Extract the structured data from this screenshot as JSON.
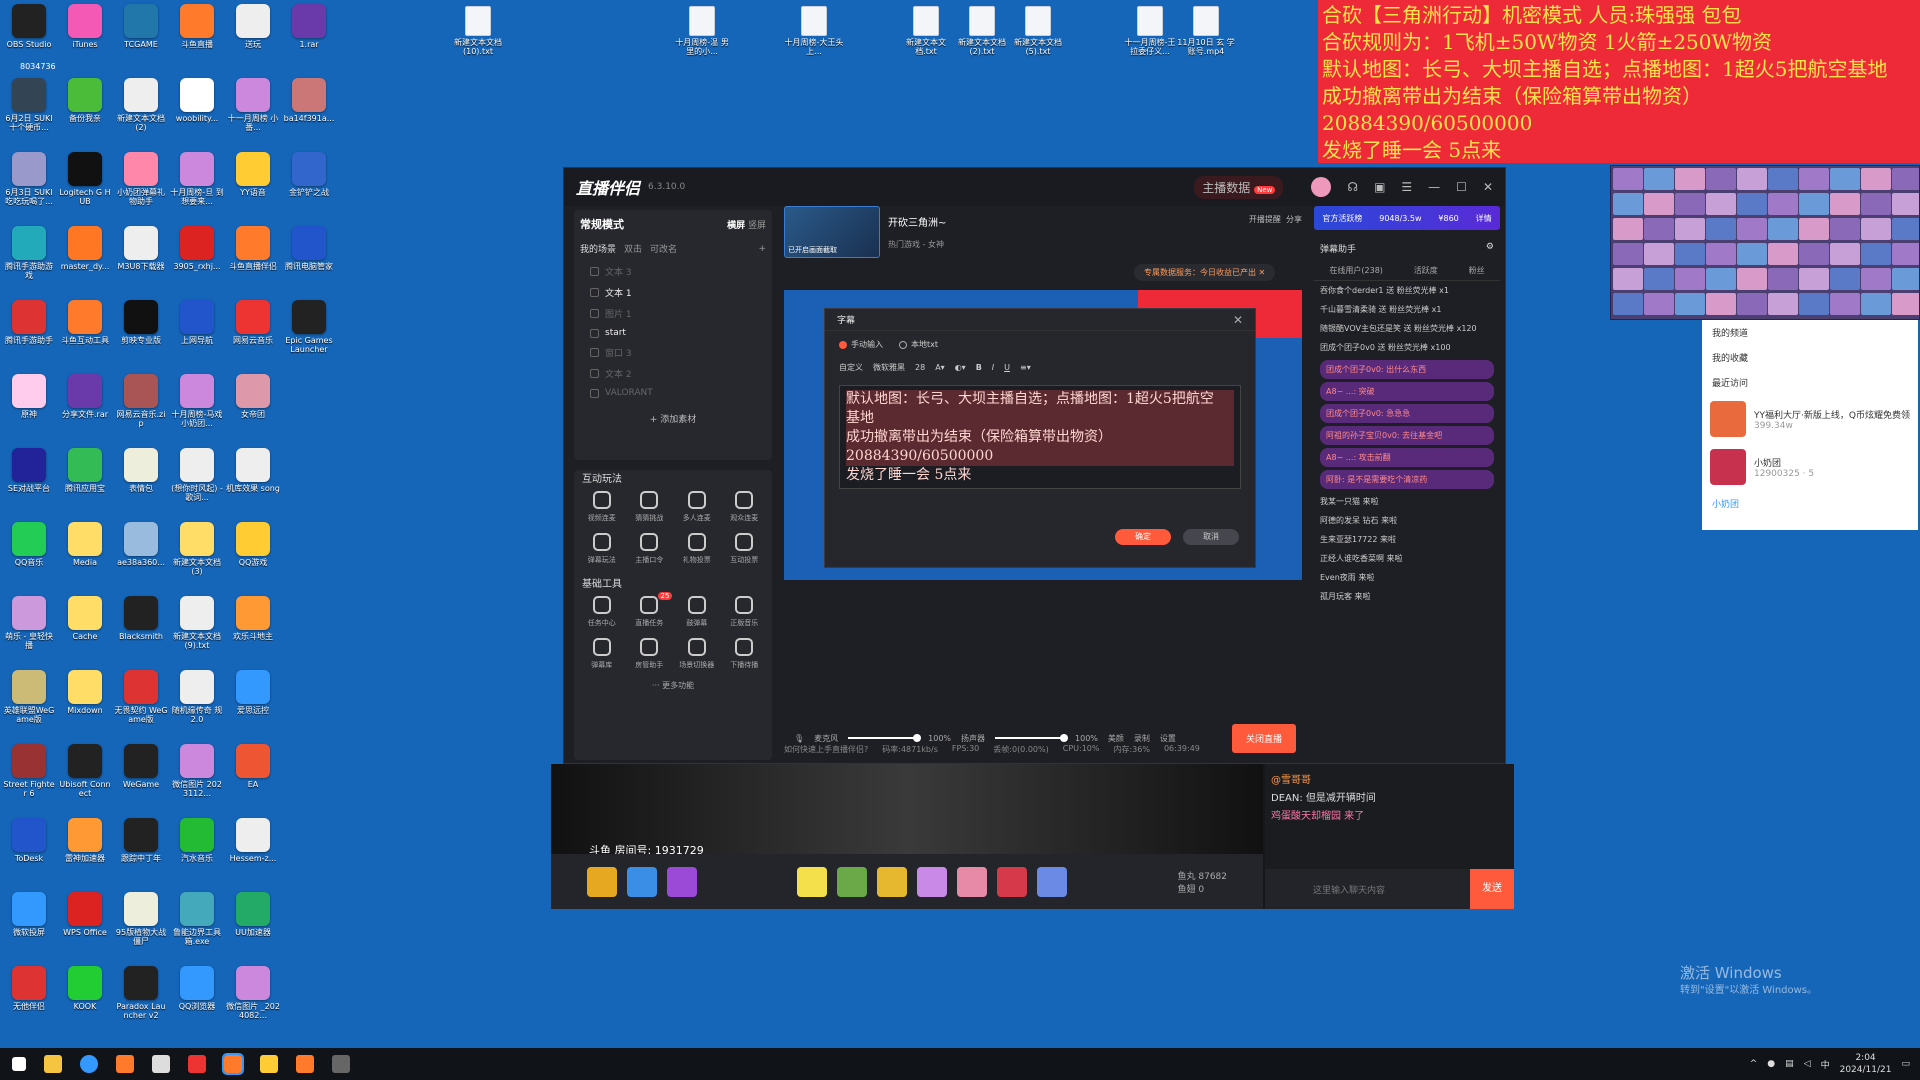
{
  "desktop": {
    "icons": [
      {
        "label": "OBS Studio",
        "color": "#222"
      },
      {
        "label": "iTunes",
        "color": "#f45ab5"
      },
      {
        "label": "TCGAME",
        "color": "#27a"
      },
      {
        "label": "斗鱼直播",
        "color": "#ff7a2a"
      },
      {
        "label": "送玩",
        "color": "#eee"
      },
      {
        "label": "1.rar",
        "color": "#6a3aaa"
      },
      {
        "label": "6月2日 SUKI 十个硬币...",
        "color": "#345"
      },
      {
        "label": "备份我亲",
        "color": "#4bbb3a"
      },
      {
        "label": "新建文本文档 (2)",
        "color": "#eee"
      },
      {
        "label": "woobility...",
        "color": "#fff"
      },
      {
        "label": "十一月周榜 小番...",
        "color": "#c8d"
      },
      {
        "label": "ba14f391a...",
        "color": "#c77"
      },
      {
        "label": "6月3日 SUKI 吃吃玩喝了...",
        "color": "#99c"
      },
      {
        "label": "Logitech G HUB",
        "color": "#111"
      },
      {
        "label": "小奶团弹幕礼物助手",
        "color": "#f8a"
      },
      {
        "label": "十月周榜-旦 到想要来...",
        "color": "#c8d"
      },
      {
        "label": "YY语音",
        "color": "#fc3"
      },
      {
        "label": "金铲铲之战",
        "color": "#36c"
      },
      {
        "label": "腾讯手游助游戏",
        "color": "#2ab"
      },
      {
        "label": "master_dy...",
        "color": "#f72"
      },
      {
        "label": "M3U8下载器",
        "color": "#eee"
      },
      {
        "label": "3905_rxhj...",
        "color": "#d22"
      },
      {
        "label": "斗鱼直播伴侣",
        "color": "#ff7a2a"
      },
      {
        "label": "腾讯电脑管家",
        "color": "#25c"
      },
      {
        "label": "腾讯手游助手",
        "color": "#d33"
      },
      {
        "label": "斗鱼互动工具",
        "color": "#ff7a2a"
      },
      {
        "label": "剪映专业版",
        "color": "#111"
      },
      {
        "label": "上网导航",
        "color": "#25c"
      },
      {
        "label": "网易云音乐",
        "color": "#e33"
      },
      {
        "label": "Epic Games Launcher",
        "color": "#222"
      },
      {
        "label": "原神",
        "color": "#fce"
      },
      {
        "label": "分享文件.rar",
        "color": "#6a3aaa"
      },
      {
        "label": "网易云音乐.zip",
        "color": "#a55"
      },
      {
        "label": "十月周榜-马戏小奶团...",
        "color": "#c8d"
      },
      {
        "label": "女帝团",
        "color": "#d9a"
      },
      {
        "label": "",
        "color": "#1565b8"
      },
      {
        "label": "SE对战平台",
        "color": "#229"
      },
      {
        "label": "腾讯应用宝",
        "color": "#3b5"
      },
      {
        "label": "表情包",
        "color": "#eed"
      },
      {
        "label": "(想你时风起) - 歌词...",
        "color": "#eee"
      },
      {
        "label": "机库效果 song",
        "color": "#eee"
      },
      {
        "label": "",
        "color": "#1565b8"
      },
      {
        "label": "QQ音乐",
        "color": "#2c5"
      },
      {
        "label": "Media",
        "color": "#fd6"
      },
      {
        "label": "ae38a360...",
        "color": "#9bd"
      },
      {
        "label": "新建文本文档 (3)",
        "color": "#fd6"
      },
      {
        "label": "QQ游戏",
        "color": "#fc3"
      },
      {
        "label": "",
        "color": "#1565b8"
      },
      {
        "label": "萌乐 - 皇轻快播",
        "color": "#c9d"
      },
      {
        "label": "Cache",
        "color": "#fd6"
      },
      {
        "label": "Blacksmith",
        "color": "#222"
      },
      {
        "label": "新建文本文档 (9).txt",
        "color": "#eee"
      },
      {
        "label": "欢乐斗地主",
        "color": "#f93"
      },
      {
        "label": "",
        "color": "#1565b8"
      },
      {
        "label": "英雄联盟WeGame版",
        "color": "#cb7"
      },
      {
        "label": "Mixdown",
        "color": "#fd6"
      },
      {
        "label": "无畏契约 WeGame版",
        "color": "#d33"
      },
      {
        "label": "随机缘传奇 规2.0",
        "color": "#eee"
      },
      {
        "label": "爱思远控",
        "color": "#39f"
      },
      {
        "label": "",
        "color": "#1565b8"
      },
      {
        "label": "Street Fighter 6",
        "color": "#933"
      },
      {
        "label": "Ubisoft Connect",
        "color": "#222"
      },
      {
        "label": "WeGame",
        "color": "#222"
      },
      {
        "label": "微信图片 2023112...",
        "color": "#c8d"
      },
      {
        "label": "EA",
        "color": "#e53"
      },
      {
        "label": "",
        "color": "#1565b8"
      },
      {
        "label": "ToDesk",
        "color": "#25c"
      },
      {
        "label": "雷神加速器",
        "color": "#f93"
      },
      {
        "label": "跟踪中丁年",
        "color": "#222"
      },
      {
        "label": "汽水音乐",
        "color": "#2b3"
      },
      {
        "label": "Hessem-z...",
        "color": "#eee"
      },
      {
        "label": "",
        "color": "#1565b8"
      },
      {
        "label": "微软投屏",
        "color": "#39f"
      },
      {
        "label": "WPS Office",
        "color": "#d22"
      },
      {
        "label": "95版植物大战僵尸",
        "color": "#eed"
      },
      {
        "label": "鲁能边界工具箱.exe",
        "color": "#4ab"
      },
      {
        "label": "UU加速器",
        "color": "#2a6"
      },
      {
        "label": "",
        "color": "#1565b8"
      },
      {
        "label": "无他伴侣",
        "color": "#d33"
      },
      {
        "label": "KOOK",
        "color": "#2c3"
      },
      {
        "label": "Paradox Launcher v2",
        "color": "#222"
      },
      {
        "label": "QQ浏览器",
        "color": "#39f"
      },
      {
        "label": "微信图片 _2024082...",
        "color": "#c8d"
      },
      {
        "label": "",
        "color": "#1565b8"
      }
    ],
    "obs_extra": "8034736",
    "top_files": [
      {
        "label": "新建文本文档 (10).txt"
      },
      {
        "label": "十月周榜-温 男里的小..."
      },
      {
        "label": "十月周榜-大王头上..."
      },
      {
        "label": "新建文本文档.txt"
      },
      {
        "label": "新建文本文档 (2).txt"
      },
      {
        "label": "新建文本文档 (5).txt"
      },
      {
        "label": "十一月周榜-王 拉委仔义..."
      },
      {
        "label": "11月10日 玄 学账号.mp4"
      }
    ]
  },
  "overlay": {
    "lines": [
      "合砍【三角洲行动】机密模式 人员:珠强强 包包",
      "合砍规则为：1飞机±50W物资 1火箭±250W物资",
      "默认地图：长弓、大坝主播自选；点播地图：1超火5把航空基地",
      "成功撤离带出为结束（保险箱算带出物资）",
      "20884390/60500000",
      "发烧了睡一会 5点来"
    ]
  },
  "sidepanel": {
    "items": [
      "我的频道",
      "我的收藏",
      "最近访问"
    ],
    "live1": {
      "title": "YY福利大厅·新版上线，Q币炫耀免费领",
      "count": "399.34w"
    },
    "live2": {
      "title": "小奶团",
      "id": "12900325",
      "count": "5"
    },
    "footer": "小奶团"
  },
  "app": {
    "title": "直播伴侣",
    "version": "6.3.10.0",
    "pill": "主播数据",
    "pill_badge": "New",
    "mode": "常规模式",
    "tab_landscape": "横屏",
    "tab_portrait": "竖屏",
    "scene_tabs": [
      "我的场景",
      "双击",
      "可改名"
    ],
    "scenes": [
      {
        "label": "文本 3",
        "on": false
      },
      {
        "label": "文本 1",
        "on": true
      },
      {
        "label": "图片 1",
        "on": false
      },
      {
        "label": "start",
        "on": true
      },
      {
        "label": "窗口 3",
        "on": false
      },
      {
        "label": "文本 2",
        "on": false
      },
      {
        "label": "VALORANT",
        "on": false
      }
    ],
    "add_material": "+ 添加素材",
    "interactive_title": "互动玩法",
    "interactive": [
      "视频连麦",
      "猜猜挑战",
      "多人连麦",
      "观众连麦",
      "弹幕玩法",
      "主播口令",
      "礼物投票",
      "互动投票"
    ],
    "tools_title": "基础工具",
    "tools": [
      "任务中心",
      "直播任务",
      "鼓弹幕",
      "正版音乐",
      "弹幕库",
      "房管助手",
      "场景切换器",
      "下播待播"
    ],
    "tools_badge": "25",
    "more": "··· 更多功能",
    "stream_title": "开砍三角洲~",
    "stream_cat": "热门游戏 - 女神",
    "thumb_cap": "已开启画面截取",
    "notice": "专属数据服务：今日收益已产出",
    "open_reminder": "开播提醒",
    "share": "分享",
    "rank": {
      "label": "官方活跃榜",
      "value": "9048/3.5w",
      "reward": "¥860",
      "btn": "详情"
    }
  },
  "dialog": {
    "title": "字幕",
    "radio_manual": "手动输入",
    "radio_local": "本地txt",
    "fmt_style": "自定义",
    "fmt_font": "微软雅黑",
    "fmt_size": "28",
    "lines": [
      "默认地图：长弓、大坝主播自选；点播地图：1超火5把航空",
      "基地",
      "成功撤离带出为结束（保险箱算带出物资）",
      "20884390/60500000",
      "发烧了睡一会 5点来"
    ],
    "ok": "确定",
    "cancel": "取消"
  },
  "audio": {
    "mic": "麦克风",
    "mic_vol": "100%",
    "speaker": "扬声器",
    "speaker_vol": "100%",
    "beauty": "美颜",
    "record": "录制",
    "settings": "设置",
    "end": "关闭直播"
  },
  "status": {
    "hint": "如何快速上手直播伴侣?",
    "bitrate": "码率:4871kb/s",
    "fps": "FPS:30",
    "dropped": "丢帧:0(0.00%)",
    "cpu": "CPU:10%",
    "mem": "内存:36%",
    "time": "06:39:49"
  },
  "danmu": {
    "title": "弹幕助手",
    "tabs": [
      "在线用户(238)",
      "活跃度",
      "粉丝"
    ],
    "messages": [
      {
        "text": "吞你食个derder1 送 粉丝荧光棒 x1",
        "pink": false
      },
      {
        "text": "千山暮雪清柔骑 送 粉丝荧光棒 x1",
        "pink": false
      },
      {
        "text": "随银酷VOV主包还是笑 送 粉丝荧光棒 x120",
        "pink": false
      },
      {
        "text": "团成个团子0v0 送 粉丝荧光棒 x100",
        "pink": false
      },
      {
        "text": "团成个团子0v0: 出什么东西",
        "pink": true
      },
      {
        "text": "A8~ ...: 突破",
        "pink": true
      },
      {
        "text": "团成个团子0v0: 急急急",
        "pink": true
      },
      {
        "text": "阿祖的孙子宝贝0v0: 去往基金吧",
        "pink": true
      },
      {
        "text": "A8~ ...: 攻击前翻",
        "pink": true
      },
      {
        "text": "阿卧: 是不是需要吃个清凉药",
        "pink": true
      },
      {
        "text": "我某一只猫 来啦",
        "pink": false
      },
      {
        "text": "阿德的发呆 钻石 来啦",
        "pink": false
      },
      {
        "text": "生来亚瑟17722 来啦",
        "pink": false
      },
      {
        "text": "正经人谁吃香菜啊 来啦",
        "pink": false
      },
      {
        "text": "Even夜雨 来啦",
        "pink": false
      },
      {
        "text": "孤月玩客 来啦",
        "pink": false
      }
    ],
    "tag": "来了"
  },
  "douyu": {
    "room": "斗鱼 房间号: 1931729",
    "stats": [
      "鱼丸 87682",
      "鱼翅 0"
    ],
    "chat": [
      "DEAN: 但是减开辆时间",
      "鸡蛋酸天却榴园 来了"
    ],
    "chat_head": "@雪哥哥",
    "input_ph": "这里输入聊天内容",
    "send": "发送"
  },
  "watermark": {
    "line1": "激活 Windows",
    "line2": "转到\"设置\"以激活 Windows。"
  },
  "taskbar": {
    "time": "2:04",
    "date": "2024/11/21",
    "ime": "中"
  }
}
